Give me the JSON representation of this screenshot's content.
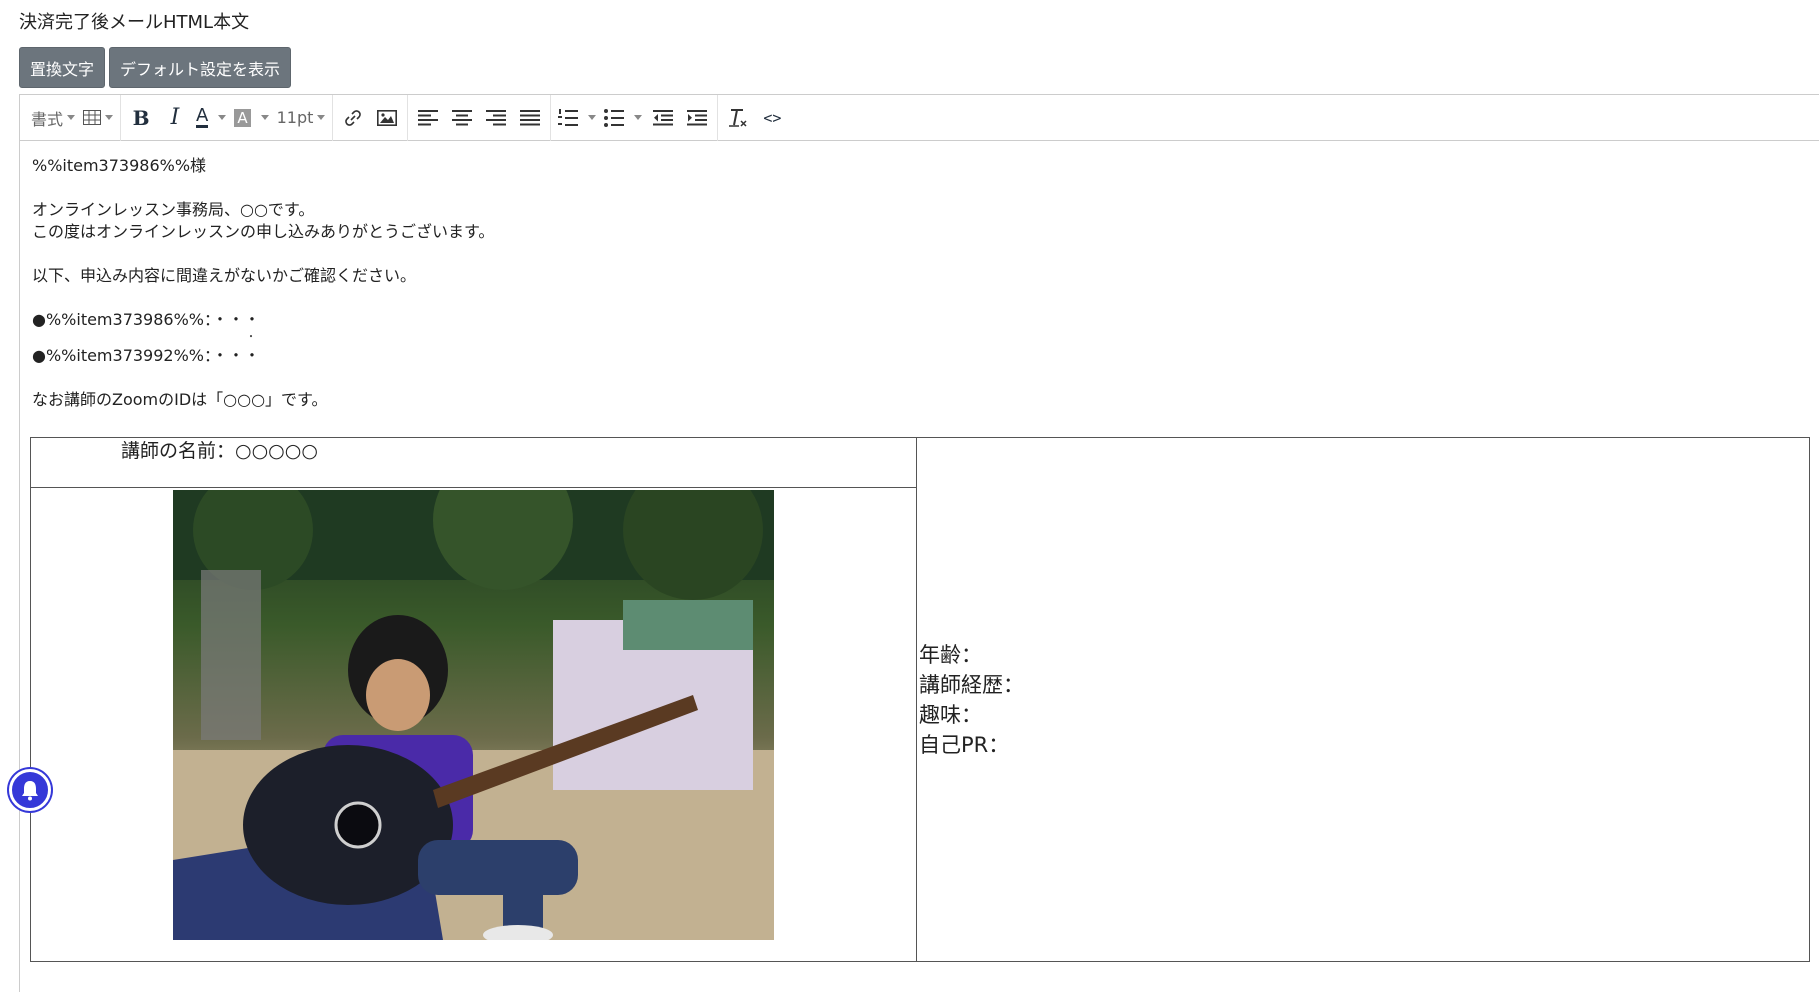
{
  "field_title": "決済完了後メールHTML本文",
  "buttons": {
    "replace_text": "置換文字",
    "show_default": "デフォルト設定を表示"
  },
  "toolbar": {
    "format_label": "書式",
    "font_size": "11pt",
    "bold_glyph": "B",
    "italic_glyph": "I",
    "text_color_glyph": "A",
    "bg_color_glyph": "A",
    "source_glyph": "<>"
  },
  "content": {
    "greeting": "%%item373986%%様",
    "intro_1": "オンラインレッスン事務局、○○です。",
    "intro_2": "この度はオンラインレッスンの申し込みありがとうございます。",
    "confirm": "以下、申込み内容に間違えがないかご確認ください。",
    "item_1": "●%%item373986%%：・・・",
    "item_dot": "・",
    "item_2": "●%%item373992%%：・・・",
    "zoom_note": "なお講師のZoomのIDは「○○○」です。"
  },
  "teacher_table": {
    "name_row": "講師の名前：○○○○○",
    "info": {
      "age": "年齢：",
      "career": "講師経歴：",
      "hobby": "趣味：",
      "pr": "自己PR："
    },
    "photo_alt": "guitar-player-photo"
  },
  "colors": {
    "button_bg": "#6c757d",
    "notification_bell": "#3538d8",
    "toolbar_icon": "#222f3e"
  }
}
